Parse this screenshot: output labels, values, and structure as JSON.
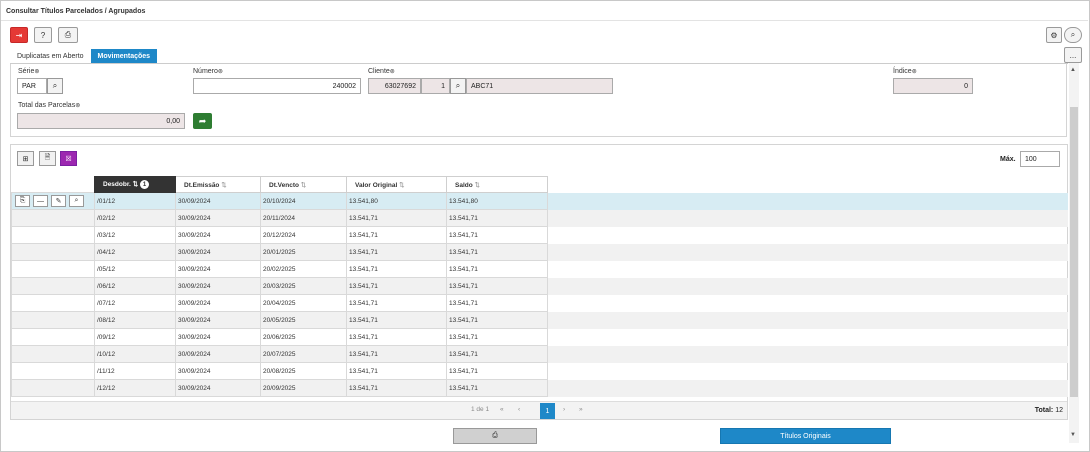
{
  "window": {
    "title": "Consultar Títulos Parcelados / Agrupados"
  },
  "toolbar": {
    "exit_icon": "exit-icon",
    "help_label": "?",
    "print_icon": "print-icon"
  },
  "top_right": {
    "settings_icon": "gear-icon",
    "search_icon": "search-icon",
    "more_label": "..."
  },
  "tabs": [
    {
      "label": "Duplicatas em Aberto",
      "active": false
    },
    {
      "label": "Movimentações",
      "active": true
    }
  ],
  "filters": {
    "serie": {
      "label": "Série",
      "value": "PAR"
    },
    "numero": {
      "label": "Número",
      "value": "240002"
    },
    "cliente": {
      "label": "Cliente",
      "code": "63027692",
      "seq": "1",
      "name": "ABC71"
    },
    "indice": {
      "label": "Índice",
      "value": "0"
    },
    "total": {
      "label": "Total das Parcelas",
      "value": "0,00"
    }
  },
  "grid": {
    "max_label": "Máx.",
    "max_value": "100",
    "columns": [
      "Desdobr.",
      "Dt.Emissão",
      "Dt.Vencto",
      "Valor Original",
      "Saldo"
    ],
    "sort_badge": "1",
    "rows": [
      [
        "/01/12",
        "30/09/2024",
        "20/10/2024",
        "13.541,80",
        "13.541,80"
      ],
      [
        "/02/12",
        "30/09/2024",
        "20/11/2024",
        "13.541,71",
        "13.541,71"
      ],
      [
        "/03/12",
        "30/09/2024",
        "20/12/2024",
        "13.541,71",
        "13.541,71"
      ],
      [
        "/04/12",
        "30/09/2024",
        "20/01/2025",
        "13.541,71",
        "13.541,71"
      ],
      [
        "/05/12",
        "30/09/2024",
        "20/02/2025",
        "13.541,71",
        "13.541,71"
      ],
      [
        "/06/12",
        "30/09/2024",
        "20/03/2025",
        "13.541,71",
        "13.541,71"
      ],
      [
        "/07/12",
        "30/09/2024",
        "20/04/2025",
        "13.541,71",
        "13.541,71"
      ],
      [
        "/08/12",
        "30/09/2024",
        "20/05/2025",
        "13.541,71",
        "13.541,71"
      ],
      [
        "/09/12",
        "30/09/2024",
        "20/06/2025",
        "13.541,71",
        "13.541,71"
      ],
      [
        "/10/12",
        "30/09/2024",
        "20/07/2025",
        "13.541,71",
        "13.541,71"
      ],
      [
        "/11/12",
        "30/09/2024",
        "20/08/2025",
        "13.541,71",
        "13.541,71"
      ],
      [
        "/12/12",
        "30/09/2024",
        "20/09/2025",
        "13.541,71",
        "13.541,71"
      ]
    ]
  },
  "pager": {
    "range": "1 de 1",
    "current": "1",
    "total_label": "Total:",
    "total_value": "12"
  },
  "actions": {
    "print_icon": "print-icon",
    "originals_label": "Títulos Originais"
  },
  "colors": {
    "accent": "#1e88c8",
    "exit": "#e53935",
    "go": "#2e7d32",
    "purple": "#9c27b0"
  }
}
